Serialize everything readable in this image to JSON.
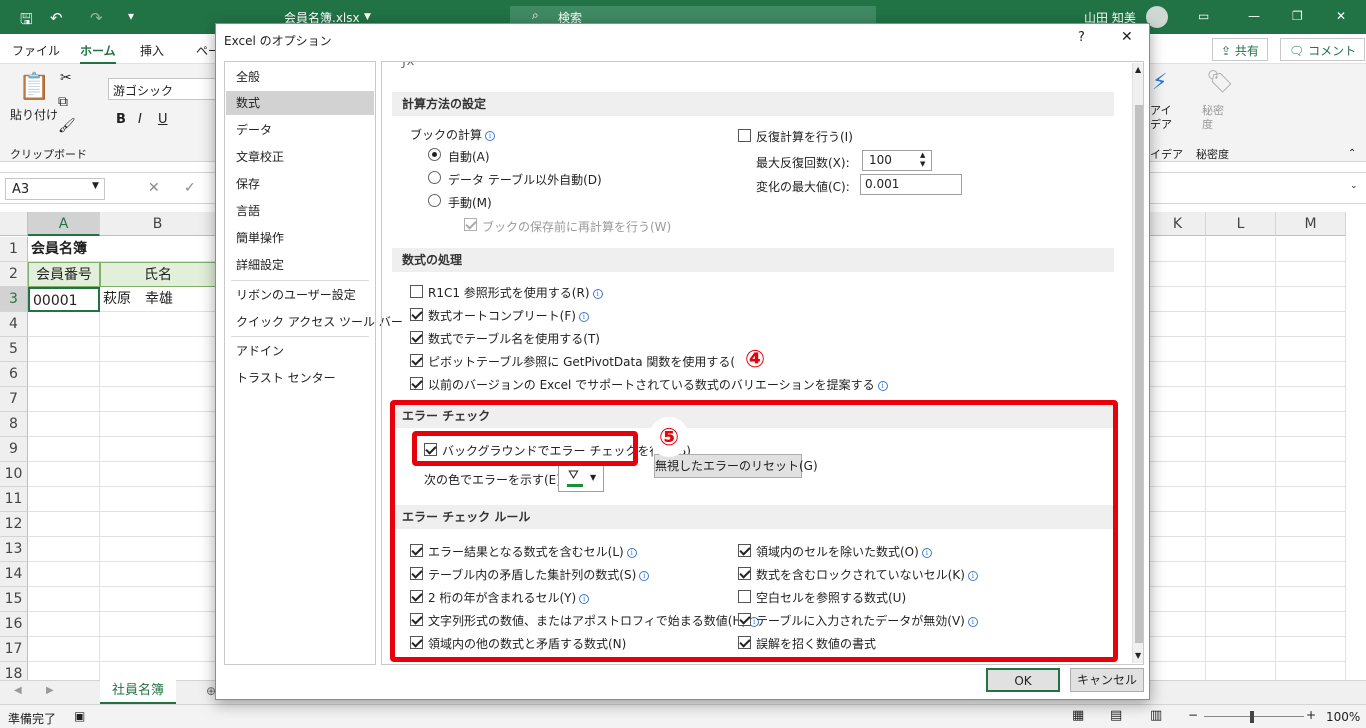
{
  "app": {
    "filename": "会員名簿.xlsx",
    "search_placeholder": "検索",
    "user": "山田 知美"
  },
  "menu": {
    "tabs": [
      "ファイル",
      "ホーム",
      "挿入",
      "ペー"
    ],
    "share": "共有",
    "comment": "コメント"
  },
  "ribbon": {
    "paste": "貼り付け",
    "clipboard": "クリップボード",
    "font": "游ゴシック",
    "bold": "B",
    "italic": "I",
    "underline": "U",
    "ideas": "アイ\nデア",
    "ideas_group": "イデア",
    "sensitivity": "秘密\n度",
    "sensitivity_group": "秘密度"
  },
  "formula": {
    "namebox": "A3"
  },
  "sheet": {
    "columns": [
      "A",
      "B",
      "K",
      "L",
      "M"
    ],
    "rows": [
      "1",
      "2",
      "3",
      "4",
      "5",
      "6",
      "7",
      "8",
      "9",
      "10",
      "11",
      "12",
      "13",
      "14",
      "15",
      "16",
      "17",
      "18"
    ],
    "a1": "会員名簿",
    "a2": "会員番号",
    "b2": "氏名",
    "a3": "00001",
    "b3": "萩原　幸雄",
    "tab": "社員名簿"
  },
  "status": {
    "ready": "準備完了",
    "zoom": "100%"
  },
  "dialog": {
    "title": "Excel のオプション",
    "help": "?",
    "close": "✕",
    "nav": [
      "全般",
      "数式",
      "データ",
      "文章校正",
      "保存",
      "言語",
      "簡単操作",
      "詳細設定",
      "リボンのユーザー設定",
      "クイック アクセス ツール バー",
      "アドイン",
      "トラスト センター"
    ],
    "calc": {
      "header": "計算方法の設定",
      "book_calc": "ブックの計算",
      "auto": "自動(A)",
      "auto_except": "データ テーブル以外自動(D)",
      "manual": "手動(M)",
      "recalc_before_save": "ブックの保存前に再計算を行う(W)",
      "iterative": "反復計算を行う(I)",
      "max_iter_label": "最大反復回数(X):",
      "max_iter": "100",
      "max_change_label": "変化の最大値(C):",
      "max_change": "0.001"
    },
    "formulas": {
      "header": "数式の処理",
      "items": [
        "R1C1 参照形式を使用する(R)",
        "数式オートコンプリート(F)",
        "数式でテーブル名を使用する(T)",
        "ピボットテーブル参照に GetPivotData 関数を使用する(P)",
        "以前のバージョンの Excel でサポートされている数式のバリエーションを提案する"
      ]
    },
    "errorcheck": {
      "header": "エラー チェック",
      "background": "バックグラウンドでエラー チェックを行う(B)",
      "reset": "無視したエラーのリセット(G)",
      "color_label": "次の色でエラーを示す(E):"
    },
    "rules": {
      "header": "エラー チェック ルール",
      "left": [
        "エラー結果となる数式を含むセル(L)",
        "テーブル内の矛盾した集計列の数式(S)",
        "2 桁の年が含まれるセル(Y)",
        "文字列形式の数値、またはアポストロフィで始まる数値(H)",
        "領域内の他の数式と矛盾する数式(N)"
      ],
      "right": [
        "領域内のセルを除いた数式(O)",
        "数式を含むロックされていないセル(K)",
        "空白セルを参照する数式(U)",
        "テーブルに入力されたデータが無効(V)",
        "誤解を招く数値の書式"
      ]
    },
    "ok": "OK",
    "cancel": "キャンセル"
  },
  "badges": {
    "step4": "④",
    "step5": "⑤"
  }
}
